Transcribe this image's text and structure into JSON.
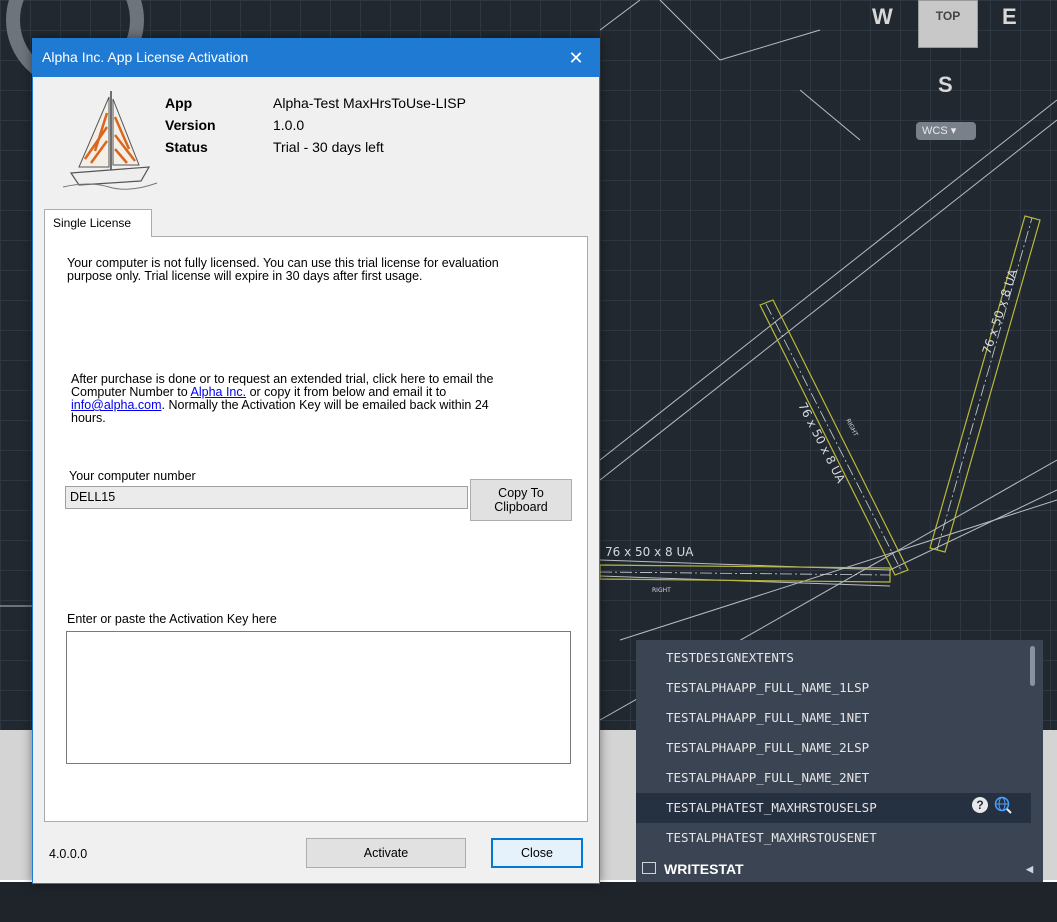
{
  "cad": {
    "compass": {
      "west": "W",
      "east": "E",
      "south": "S",
      "top_face": "TOP"
    },
    "wcs_label": "WCS ▾",
    "member_labels": [
      "76 x 50 x 8 UA",
      "76 x 50 x 8 UA",
      "76 x 50 x 8 UA"
    ],
    "tag_labels": [
      "RIGHT",
      "RIGHT"
    ]
  },
  "autocomplete": {
    "items": [
      "TESTDESIGNEXTENTS",
      "TESTALPHAAPP_FULL_NAME_1LSP",
      "TESTALPHAAPP_FULL_NAME_1NET",
      "TESTALPHAAPP_FULL_NAME_2LSP",
      "TESTALPHAAPP_FULL_NAME_2NET",
      "TESTALPHATEST_MAXHRSTOUSELSP",
      "TESTALPHATEST_MAXHRSTOUSENET"
    ],
    "selected_index": 5,
    "help_icon": "question-circle-icon",
    "web_icon": "globe-search-icon",
    "command": "WRITESTAT"
  },
  "dialog": {
    "title": "Alpha Inc. App License Activation",
    "close_glyph": "✕",
    "info": [
      {
        "label": "App",
        "value": "Alpha-Test MaxHrsToUse-LISP"
      },
      {
        "label": "Version",
        "value": "1.0.0"
      },
      {
        "label": "Status",
        "value": "Trial - 30 days left"
      }
    ],
    "tab_label": "Single License",
    "trial_notice_1": "Your computer is not fully licensed. You can use this trial license for evaluation",
    "trial_notice_2": "purpose only. Trial license will expire in 30 days after first usage.",
    "purchase_line_1": "After purchase is done or to request an extended trial, click here to email the",
    "purchase_line_2_pre": "Computer Number to ",
    "purchase_link_company": "Alpha Inc.",
    "purchase_line_2_post": " or copy it from below and email it to",
    "purchase_link_email": "info@alpha.com",
    "purchase_line_3_post": ". Normally the Activation Key will be emailed back within 24",
    "purchase_line_4": "hours.",
    "computer_number_label": "Your computer number",
    "computer_number_value": "DELL15",
    "copy_button_line1": "Copy To",
    "copy_button_line2": "Clipboard",
    "activation_key_label": "Enter or paste the Activation Key here",
    "activation_key_value": "",
    "footer_version": "4.0.0.0",
    "activate_label": "Activate",
    "close_label": "Close"
  }
}
